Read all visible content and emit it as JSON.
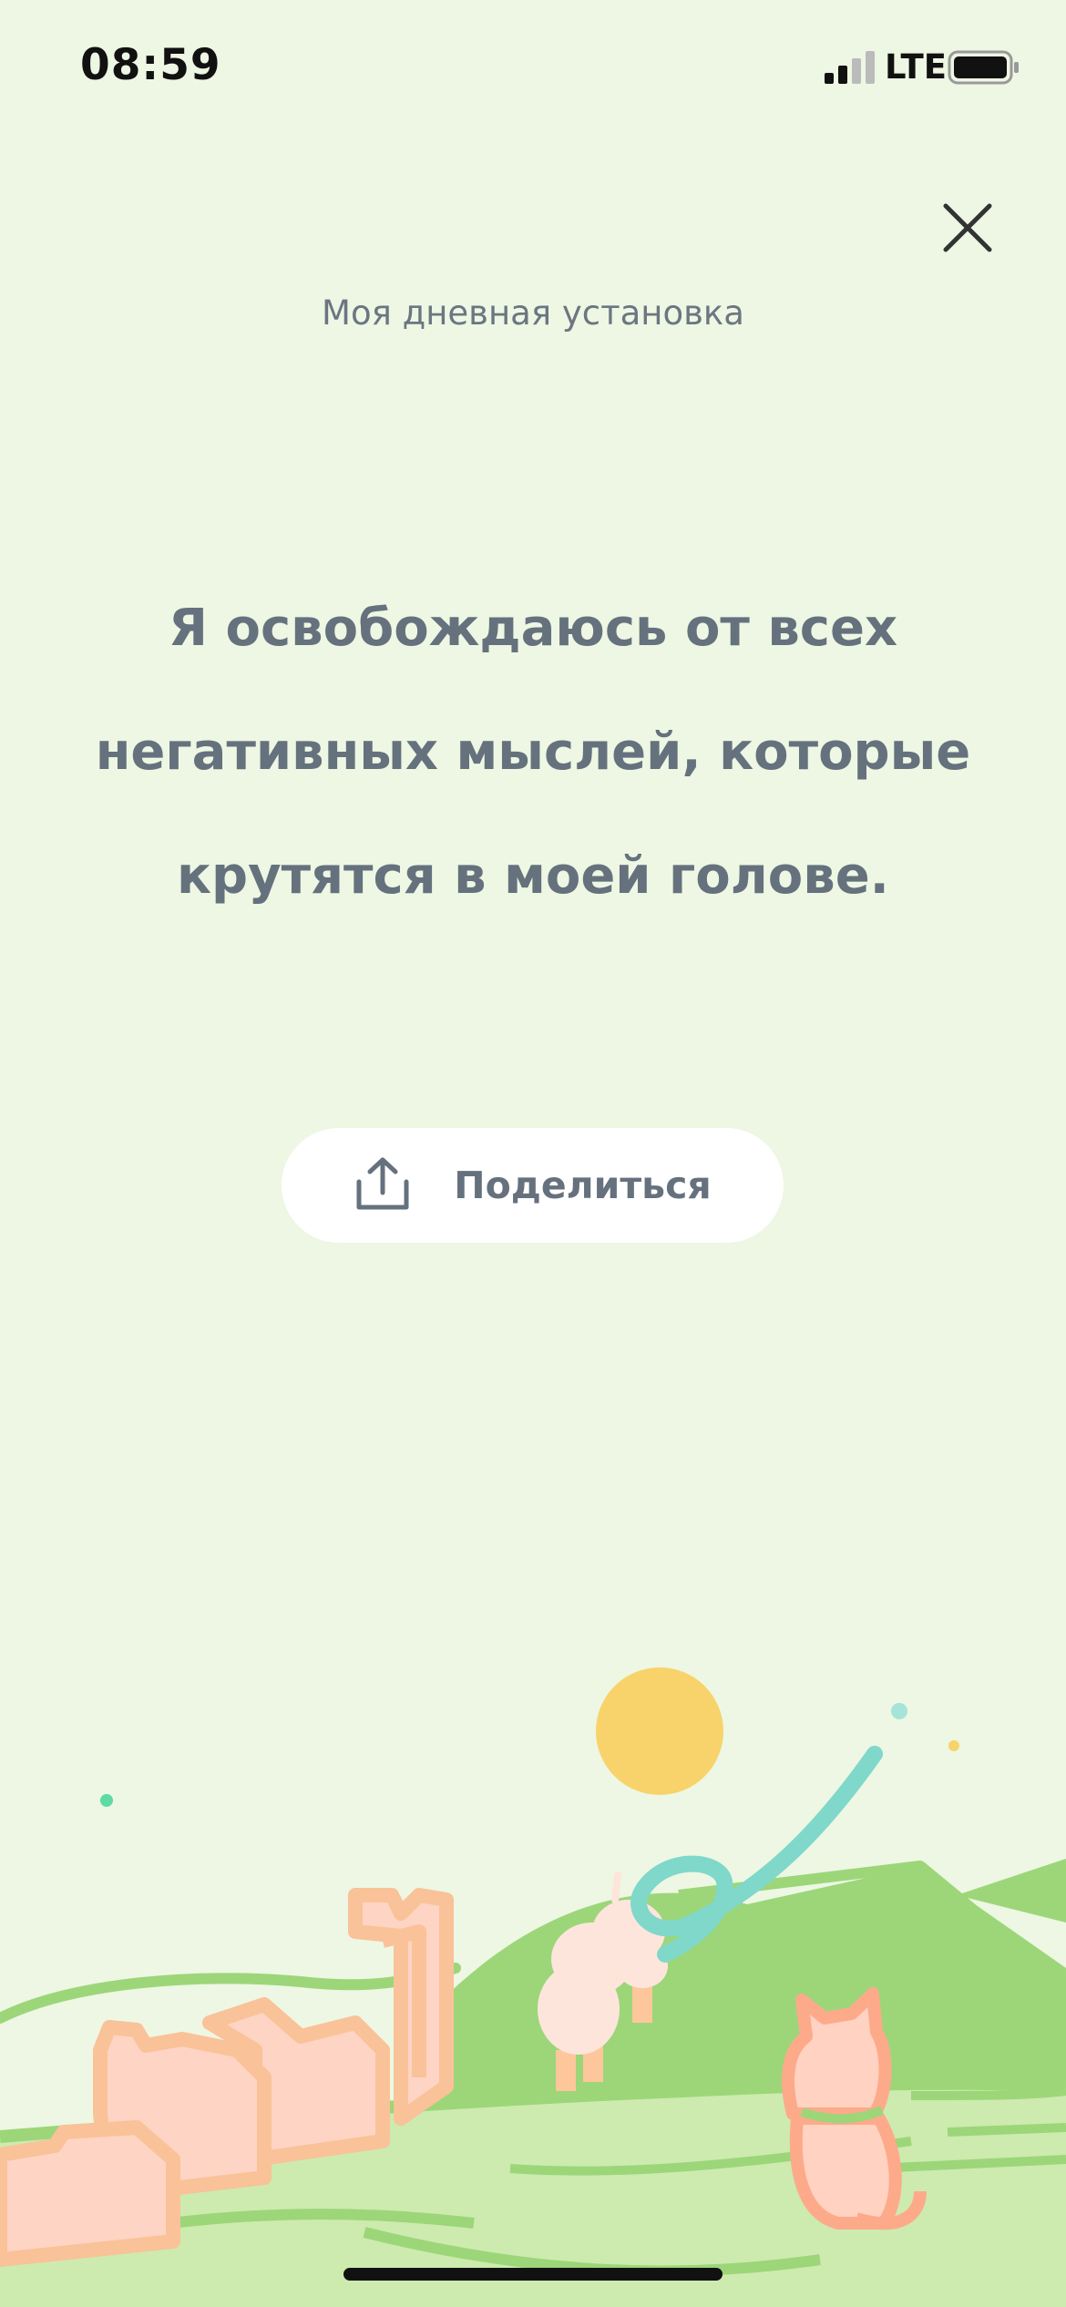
{
  "status_bar": {
    "time": "08:59",
    "network": "LTE",
    "signal_icon": "cellular-signal-icon",
    "battery_icon": "battery-icon"
  },
  "header": {
    "close_icon": "close-icon",
    "subtitle": "Моя дневная установка"
  },
  "affirmation": {
    "text": "Я освобождаюсь от всех негативных мыслей, которые крутятся в моей голове."
  },
  "share": {
    "icon": "share-icon",
    "label": "Поделиться"
  },
  "illustration": {
    "icon": "landscape-illustration"
  },
  "colors": {
    "background": "#EDF7E3",
    "text": "#66717E",
    "hills": "#9CD679",
    "light_hills": "#CDEBAE",
    "sun": "#F8D36B",
    "building_fill": "#FED4C4",
    "building_stroke": "#F9C298",
    "cat": "#FDAA8B",
    "ribbon": "#7FD8CA"
  }
}
